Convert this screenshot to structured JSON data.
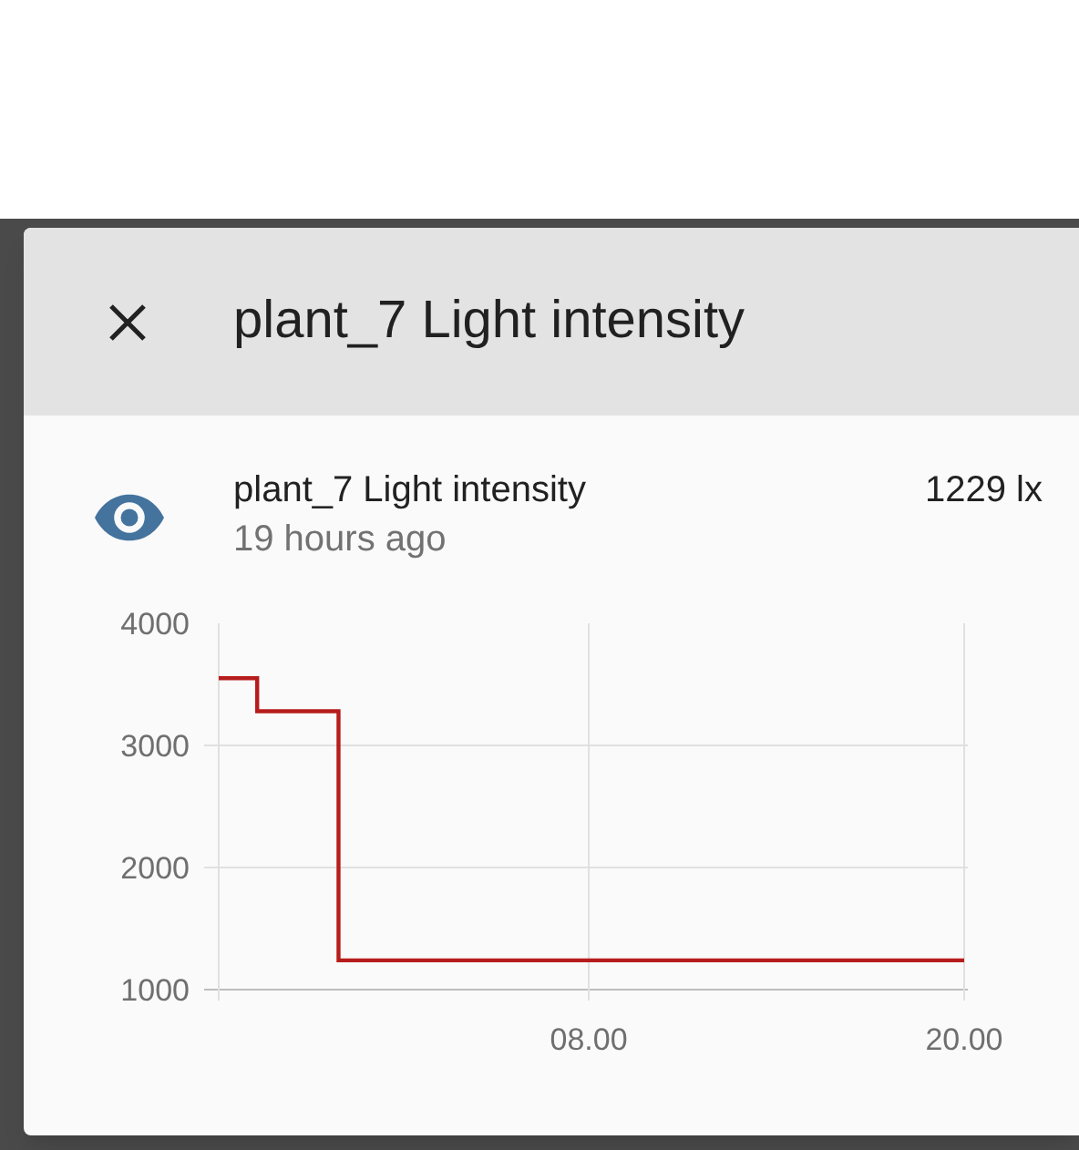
{
  "dialog": {
    "title": "plant_7 Light intensity"
  },
  "entity": {
    "name": "plant_7 Light intensity",
    "time": "19 hours ago",
    "state": "1229 lx"
  },
  "chart_data": {
    "type": "line",
    "x": [
      -3.83,
      -2.6,
      -2.6,
      0.0,
      0.0,
      20
    ],
    "series": [
      {
        "color": "#b71c1c",
        "values": [
          3550,
          3550,
          3280,
          3280,
          1240,
          1240
        ]
      }
    ],
    "xlim": [
      -3.83,
      20
    ],
    "ylim": [
      1000,
      4000
    ],
    "xticks": [
      {
        "value": 8,
        "label": "08.00"
      },
      {
        "value": 20,
        "label": "20.00"
      }
    ],
    "yticks": [
      1000,
      2000,
      3000,
      4000
    ],
    "grid": true
  }
}
